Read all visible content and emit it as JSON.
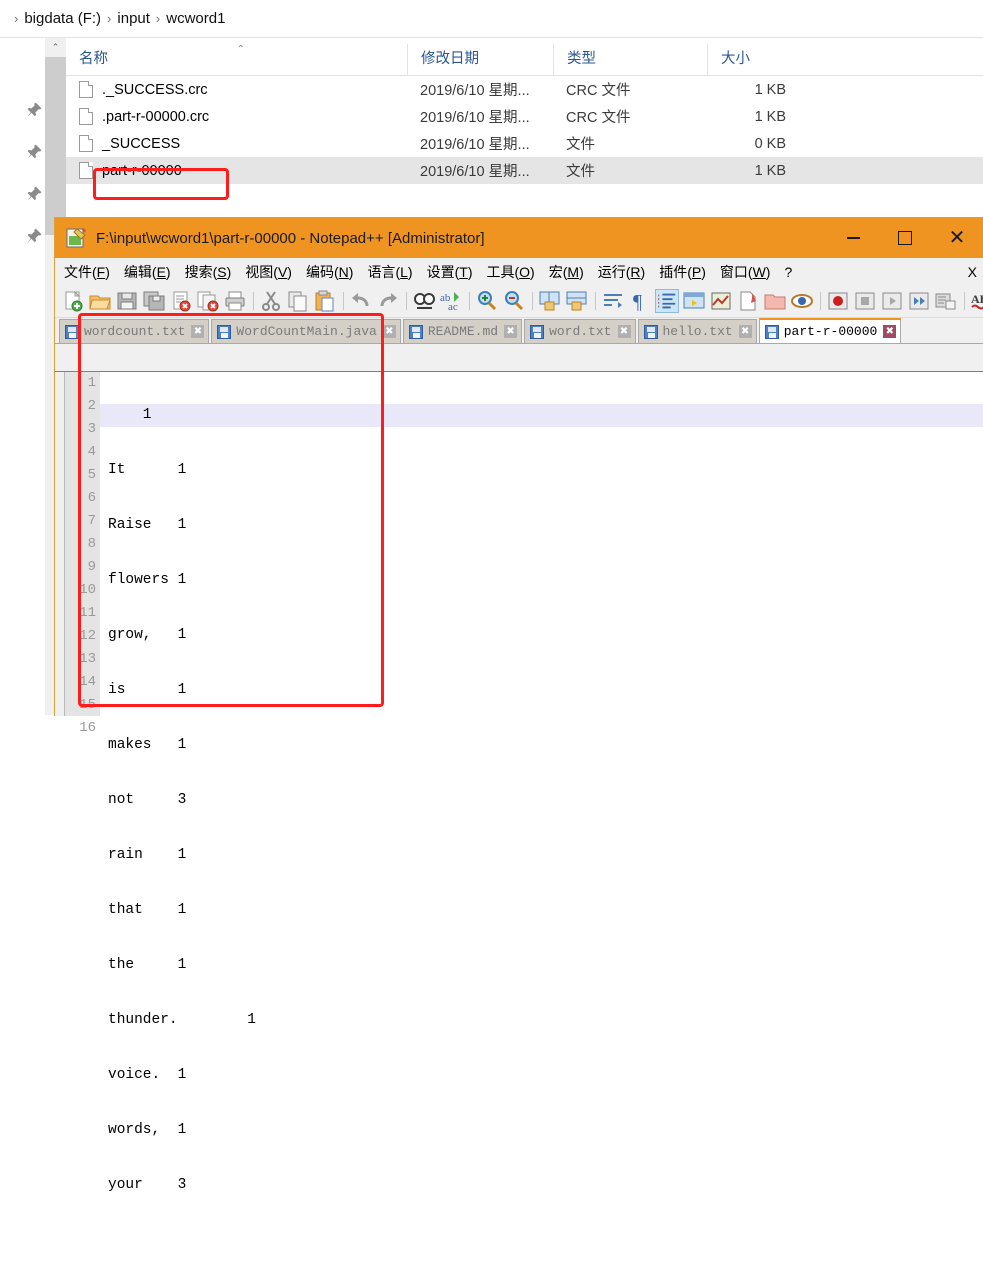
{
  "explorer": {
    "breadcrumb": {
      "chevron": "›",
      "segments": [
        "bigdata (F:)",
        "input",
        "wcword1"
      ]
    },
    "scroll_up_icon": "⌃",
    "sort_caret": "⌃",
    "columns": [
      {
        "label": "名称",
        "key": "name"
      },
      {
        "label": "修改日期",
        "key": "date"
      },
      {
        "label": "类型",
        "key": "type"
      },
      {
        "label": "大小",
        "key": "size"
      }
    ],
    "rows": [
      {
        "name": "._SUCCESS.crc",
        "date": "2019/6/10 星期...",
        "type": "CRC 文件",
        "size": "1 KB",
        "selected": false
      },
      {
        "name": ".part-r-00000.crc",
        "date": "2019/6/10 星期...",
        "type": "CRC 文件",
        "size": "1 KB",
        "selected": false
      },
      {
        "name": "_SUCCESS",
        "date": "2019/6/10 星期...",
        "type": "文件",
        "size": "0 KB",
        "selected": false
      },
      {
        "name": "part-r-00000",
        "date": "2019/6/10 星期...",
        "type": "文件",
        "size": "1 KB",
        "selected": true
      }
    ],
    "pin_count": 4
  },
  "notepad": {
    "title": "F:\\input\\wcword1\\part-r-00000 - Notepad++ [Administrator]",
    "window_buttons": {
      "minimize": "—",
      "maximize": "□",
      "close": "✕"
    },
    "menu": [
      {
        "label": "文件",
        "accel": "F"
      },
      {
        "label": "编辑",
        "accel": "E"
      },
      {
        "label": "搜索",
        "accel": "S"
      },
      {
        "label": "视图",
        "accel": "V"
      },
      {
        "label": "编码",
        "accel": "N"
      },
      {
        "label": "语言",
        "accel": "L"
      },
      {
        "label": "设置",
        "accel": "T"
      },
      {
        "label": "工具",
        "accel": "O"
      },
      {
        "label": "宏",
        "accel": "M"
      },
      {
        "label": "运行",
        "accel": "R"
      },
      {
        "label": "插件",
        "accel": "P"
      },
      {
        "label": "窗口",
        "accel": "W"
      }
    ],
    "menu_help": "?",
    "menu_close_doc": "X",
    "toolbar": [
      {
        "name": "new-file-icon"
      },
      {
        "name": "open-file-icon"
      },
      {
        "name": "save-icon"
      },
      {
        "name": "save-all-icon"
      },
      {
        "name": "close-file-icon"
      },
      {
        "name": "close-all-files-icon"
      },
      {
        "name": "print-icon"
      },
      {
        "name": "separator"
      },
      {
        "name": "cut-icon"
      },
      {
        "name": "copy-icon"
      },
      {
        "name": "paste-icon"
      },
      {
        "name": "separator"
      },
      {
        "name": "undo-icon"
      },
      {
        "name": "redo-icon"
      },
      {
        "name": "separator"
      },
      {
        "name": "find-icon"
      },
      {
        "name": "replace-icon"
      },
      {
        "name": "separator"
      },
      {
        "name": "zoom-in-icon"
      },
      {
        "name": "zoom-out-icon"
      },
      {
        "name": "separator"
      },
      {
        "name": "sync-vertical-scroll-icon"
      },
      {
        "name": "sync-horizontal-scroll-icon"
      },
      {
        "name": "separator"
      },
      {
        "name": "word-wrap-icon"
      },
      {
        "name": "show-all-chars-icon"
      },
      {
        "name": "indent-guide-icon"
      },
      {
        "name": "user-define-dialog-icon"
      },
      {
        "name": "show-map-icon"
      },
      {
        "name": "document-list-icon"
      },
      {
        "name": "folder-as-workspace-icon"
      },
      {
        "name": "monitoring-icon"
      },
      {
        "name": "separator"
      },
      {
        "name": "record-macro-icon"
      },
      {
        "name": "stop-record-icon"
      },
      {
        "name": "play-macro-icon"
      },
      {
        "name": "run-macro-multiple-icon"
      },
      {
        "name": "save-macro-icon"
      },
      {
        "name": "separator"
      },
      {
        "name": "spellcheck-icon"
      }
    ],
    "tabs": [
      {
        "label": "wordcount.txt",
        "active": false
      },
      {
        "label": "WordCountMain.java",
        "active": false
      },
      {
        "label": "README.md",
        "active": false
      },
      {
        "label": "word.txt",
        "active": false
      },
      {
        "label": "hello.txt",
        "active": false
      },
      {
        "label": "part-r-00000",
        "active": true
      }
    ],
    "tab_close_glyph": "✖",
    "editor": {
      "current_line": 1,
      "lines": [
        {
          "n": "1",
          "text": "    1"
        },
        {
          "n": "2",
          "text": "It\t1"
        },
        {
          "n": "3",
          "text": "Raise\t1"
        },
        {
          "n": "4",
          "text": "flowers\t1"
        },
        {
          "n": "5",
          "text": "grow,\t1"
        },
        {
          "n": "6",
          "text": "is\t1"
        },
        {
          "n": "7",
          "text": "makes\t1"
        },
        {
          "n": "8",
          "text": "not\t3"
        },
        {
          "n": "9",
          "text": "rain\t1"
        },
        {
          "n": "10",
          "text": "that\t1"
        },
        {
          "n": "11",
          "text": "the\t1"
        },
        {
          "n": "12",
          "text": "thunder.\t1"
        },
        {
          "n": "13",
          "text": "voice.\t1"
        },
        {
          "n": "14",
          "text": "words,\t1"
        },
        {
          "n": "15",
          "text": "your\t3"
        },
        {
          "n": "16",
          "text": ""
        }
      ]
    }
  },
  "annotations": {
    "accent_color": "#fe1c1c",
    "titlebar_color": "#ef9421",
    "selected_row_color": "#e5e5e5",
    "current_line_color": "#e8e8f8"
  }
}
